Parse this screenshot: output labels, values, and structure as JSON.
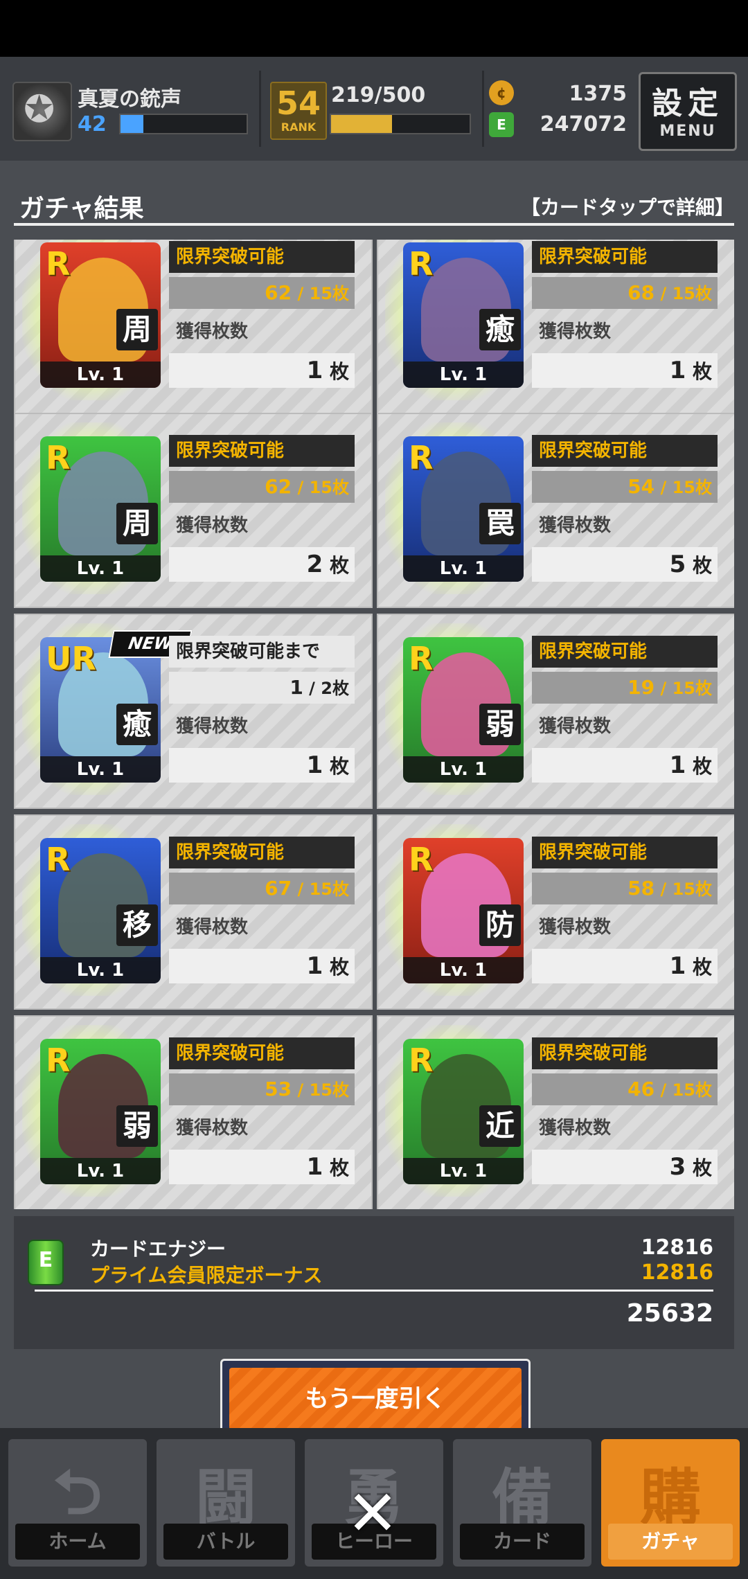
{
  "header": {
    "player_name": "真夏の銃声",
    "player_level": "42",
    "rank": "54",
    "rank_label": "RANK",
    "exp": "219/500",
    "coins": "1375",
    "energy": "247072",
    "menu_jp": "設定",
    "menu_en": "MENU"
  },
  "panel": {
    "title": "ガチャ結果",
    "hint": "【カードタップで詳細】"
  },
  "cards": [
    {
      "rarity": "R",
      "role": "周",
      "lv": "Lv. 1",
      "limit_label": "限界突破可能",
      "limit_have": "62",
      "limit_need": "15",
      "unit": "枚",
      "got_label": "獲得枚数",
      "got": "1",
      "color": "#f2b431"
    },
    {
      "rarity": "R",
      "role": "癒",
      "lv": "Lv. 1",
      "limit_label": "限界突破可能",
      "limit_have": "68",
      "limit_need": "15",
      "unit": "枚",
      "got_label": "獲得枚数",
      "got": "1",
      "color": "#8a6a9a"
    },
    {
      "rarity": "R",
      "role": "周",
      "lv": "Lv. 1",
      "limit_label": "限界突破可能",
      "limit_have": "62",
      "limit_need": "15",
      "unit": "枚",
      "got_label": "獲得枚数",
      "got": "2",
      "color": "#7a8aa8"
    },
    {
      "rarity": "R",
      "role": "罠",
      "lv": "Lv. 1",
      "limit_label": "限界突破可能",
      "limit_have": "54",
      "limit_need": "15",
      "unit": "枚",
      "got_label": "獲得枚数",
      "got": "5",
      "color": "#4a5a7a"
    },
    {
      "rarity": "UR",
      "role": "癒",
      "lv": "Lv. 1",
      "limit_label": "限界突破可能まで",
      "limit_have": "1",
      "limit_need": "2",
      "unit": "枚",
      "got_label": "獲得枚数",
      "got": "1",
      "color": "#9ad0e0",
      "is_new": true,
      "new_label": "NEW"
    },
    {
      "rarity": "R",
      "role": "弱",
      "lv": "Lv. 1",
      "limit_label": "限界突破可能",
      "limit_have": "19",
      "limit_need": "15",
      "unit": "枚",
      "got_label": "獲得枚数",
      "got": "1",
      "color": "#e85aa0"
    },
    {
      "rarity": "R",
      "role": "移",
      "lv": "Lv. 1",
      "limit_label": "限界突破可能",
      "limit_have": "67",
      "limit_need": "15",
      "unit": "枚",
      "got_label": "獲得枚数",
      "got": "1",
      "color": "#5a6a5a"
    },
    {
      "rarity": "R",
      "role": "防",
      "lv": "Lv. 1",
      "limit_label": "限界突破可能",
      "limit_have": "58",
      "limit_need": "15",
      "unit": "枚",
      "got_label": "獲得枚数",
      "got": "1",
      "color": "#e878c8"
    },
    {
      "rarity": "R",
      "role": "弱",
      "lv": "Lv. 1",
      "limit_label": "限界突破可能",
      "limit_have": "53",
      "limit_need": "15",
      "unit": "枚",
      "got_label": "獲得枚数",
      "got": "1",
      "color": "#5a2a3a"
    },
    {
      "rarity": "R",
      "role": "近",
      "lv": "Lv. 1",
      "limit_label": "限界突破可能",
      "limit_have": "46",
      "limit_need": "15",
      "unit": "枚",
      "got_label": "獲得枚数",
      "got": "3",
      "color": "#3a5a2a"
    }
  ],
  "energy": {
    "label": "カードエナジー",
    "value": "12816",
    "bonus_label": "プライム会員限定ボーナス",
    "bonus_value": "12816",
    "total": "25632"
  },
  "retry_button": "もう一度引く",
  "nav": [
    {
      "glyph": "⮌",
      "label": "ホーム"
    },
    {
      "glyph": "闘",
      "label": "バトル"
    },
    {
      "glyph": "勇",
      "label": "ヒーロー"
    },
    {
      "glyph": "備",
      "label": "カード"
    },
    {
      "glyph": "購",
      "label": "ガチャ",
      "active": true
    }
  ],
  "close_label": "✕"
}
